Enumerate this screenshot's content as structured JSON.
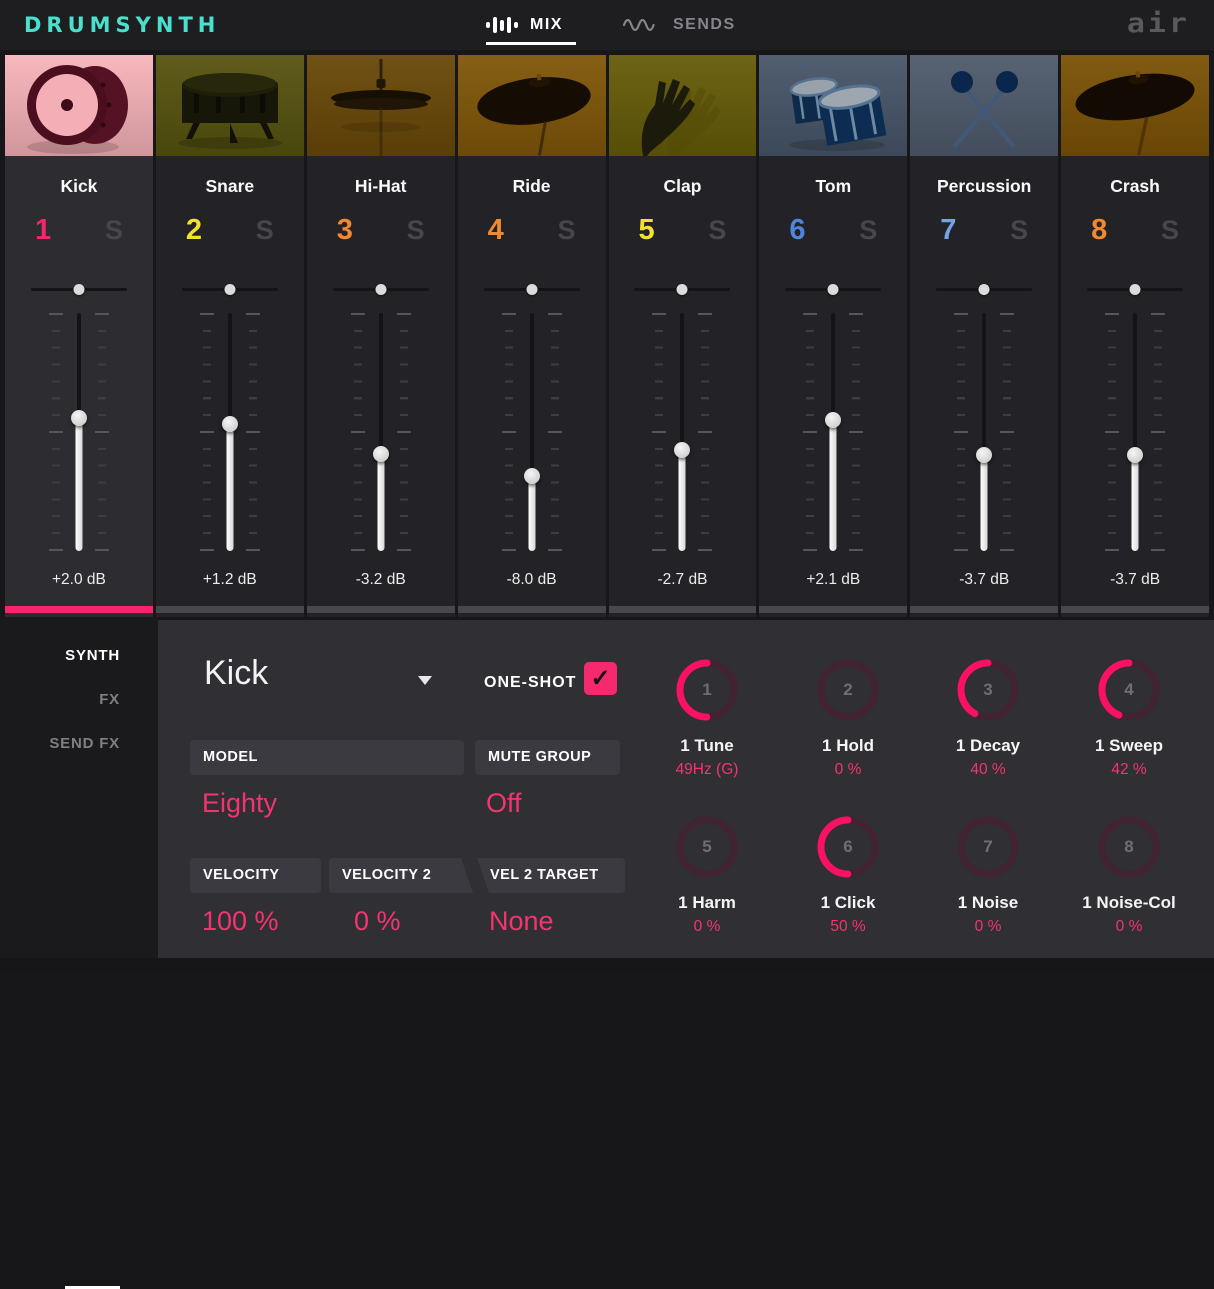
{
  "header": {
    "app_title": "DRUMSYNTH",
    "brand": "air",
    "tabs": {
      "mix": "MIX",
      "sends": "SENDS"
    }
  },
  "colors": {
    "accent_pink": "#f52a6e",
    "logo_cyan": "#49e0cd",
    "panel_bg": "#302f34",
    "selected_strip_bar": "#f8256c",
    "idle_strip_bar": "#47474c"
  },
  "channels": [
    {
      "name": "Kick",
      "number": "1",
      "number_color": "#f8256c",
      "solo_label": "S",
      "pan_pct": "50%",
      "fader_pct": "44.1%",
      "volume_db": "+2.0 dB",
      "tile_color": "#f7b3b9",
      "bar_color": "#f8256c",
      "selected": true
    },
    {
      "name": "Snare",
      "number": "2",
      "number_color": "#f2e22b",
      "solo_label": "S",
      "pan_pct": "50%",
      "fader_pct": "46.6%",
      "volume_db": "+1.2 dB",
      "tile_color": "#716c10",
      "bar_color": "#47474c",
      "selected": false
    },
    {
      "name": "Hi-Hat",
      "number": "3",
      "number_color": "#f2892e",
      "solo_label": "S",
      "pan_pct": "50%",
      "fader_pct": "59.2%",
      "volume_db": "-3.2 dB",
      "tile_color": "#8a5e07",
      "bar_color": "#47474c",
      "selected": false
    },
    {
      "name": "Ride",
      "number": "4",
      "number_color": "#f2892e",
      "solo_label": "S",
      "pan_pct": "50%",
      "fader_pct": "68.5%",
      "volume_db": "-8.0 dB",
      "tile_color": "#a87107",
      "bar_color": "#47474c",
      "selected": false
    },
    {
      "name": "Clap",
      "number": "5",
      "number_color": "#f2e22b",
      "solo_label": "S",
      "pan_pct": "50%",
      "fader_pct": "57.6%",
      "volume_db": "-2.7 dB",
      "tile_color": "#857807",
      "bar_color": "#47474c",
      "selected": false
    },
    {
      "name": "Tom",
      "number": "6",
      "number_color": "#4d86db",
      "solo_label": "S",
      "pan_pct": "50%",
      "fader_pct": "45.0%",
      "volume_db": "+2.1 dB",
      "tile_color": "#5d7089",
      "bar_color": "#47474c",
      "selected": false
    },
    {
      "name": "Percussion",
      "number": "7",
      "number_color": "#74a3e9",
      "solo_label": "S",
      "pan_pct": "50%",
      "fader_pct": "59.7%",
      "volume_db": "-3.7 dB",
      "tile_color": "#66768c",
      "bar_color": "#47474c",
      "selected": false
    },
    {
      "name": "Crash",
      "number": "8",
      "number_color": "#f2892e",
      "solo_label": "S",
      "pan_pct": "50%",
      "fader_pct": "59.7%",
      "volume_db": "-3.7 dB",
      "tile_color": "#a16b03",
      "bar_color": "#47474c",
      "selected": false
    }
  ],
  "side_tabs": [
    {
      "label": "SYNTH",
      "active": true
    },
    {
      "label": "FX",
      "active": false
    },
    {
      "label": "SEND FX",
      "active": false
    }
  ],
  "editor": {
    "instrument": "Kick",
    "one_shot": {
      "label": "ONE-SHOT",
      "checked": true,
      "check_glyph": "✓"
    },
    "fields": {
      "model": {
        "label": "MODEL",
        "value": "Eighty"
      },
      "mute_group": {
        "label": "MUTE GROUP",
        "value": "Off"
      },
      "velocity": {
        "label": "VELOCITY",
        "value": "100 %"
      },
      "velocity2": {
        "label": "VELOCITY 2",
        "value": "0 %"
      },
      "vel2target": {
        "label": "VEL 2 TARGET",
        "value": "None"
      }
    },
    "knobs": [
      {
        "index": "1",
        "label": "1 Tune",
        "value": "49Hz (G)",
        "fraction": 0.5
      },
      {
        "index": "2",
        "label": "1 Hold",
        "value": "0 %",
        "fraction": 0
      },
      {
        "index": "3",
        "label": "1 Decay",
        "value": "40 %",
        "fraction": 0.42
      },
      {
        "index": "4",
        "label": "1 Sweep",
        "value": "42 %",
        "fraction": 0.44
      },
      {
        "index": "5",
        "label": "1 Harm",
        "value": "0 %",
        "fraction": 0
      },
      {
        "index": "6",
        "label": "1 Click",
        "value": "50 %",
        "fraction": 0.5
      },
      {
        "index": "7",
        "label": "1 Noise",
        "value": "0 %",
        "fraction": 0
      },
      {
        "index": "8",
        "label": "1 Noise-Col",
        "value": "0 %",
        "fraction": 0
      }
    ]
  }
}
